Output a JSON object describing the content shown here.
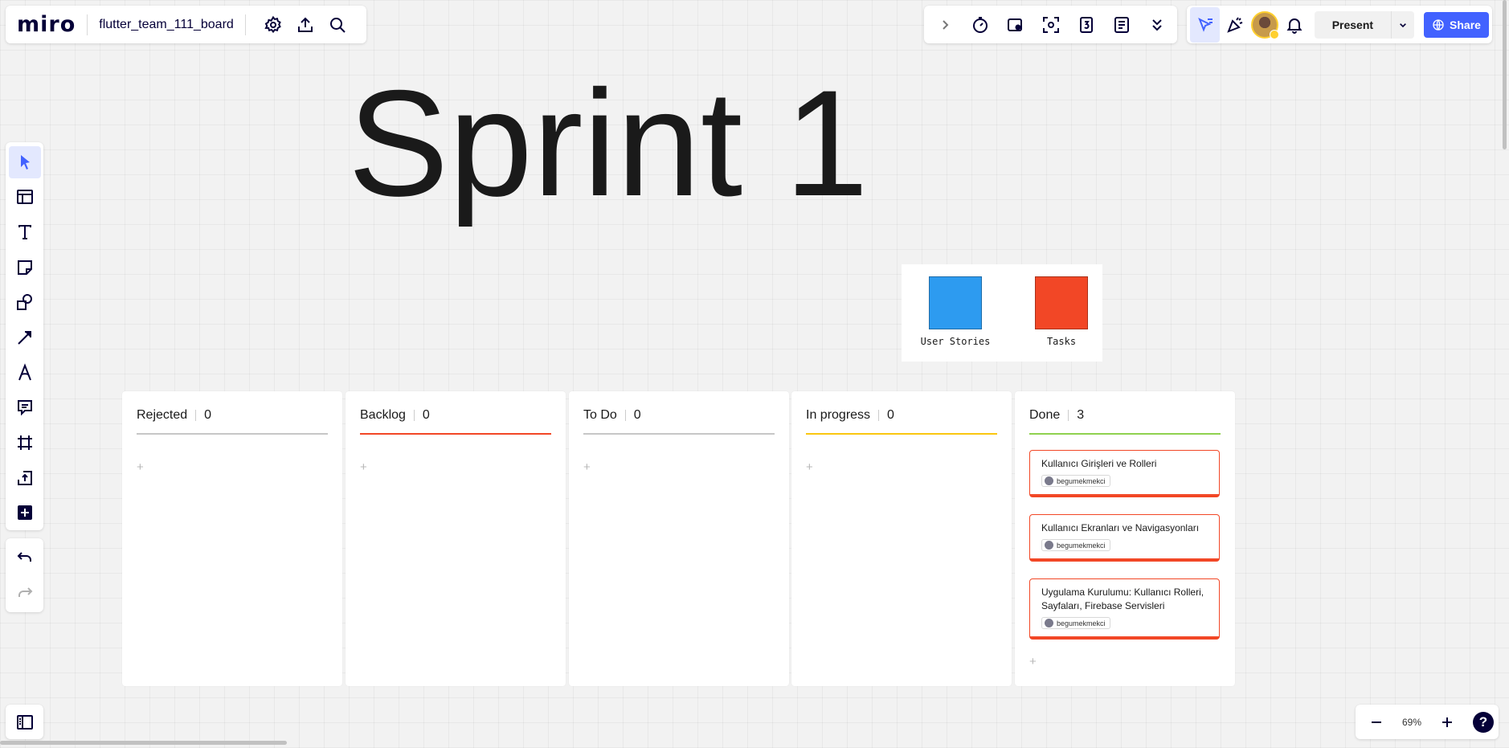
{
  "header": {
    "logo": "miro",
    "board_name": "flutter_team_111_board",
    "present_label": "Present",
    "share_label": "Share"
  },
  "icons": {
    "top_left": [
      "settings-icon",
      "upload-icon",
      "search-icon"
    ],
    "top_mid": [
      "chevron-right-icon",
      "timer-icon",
      "sticky-add-icon",
      "focus-icon",
      "counter-icon",
      "notes-icon",
      "double-chevron-down-icon"
    ],
    "top_right": [
      "cursor-filter-icon",
      "reaction-icon",
      "avatar",
      "bell-icon"
    ],
    "toolbar": [
      "select-icon",
      "templates-icon",
      "text-icon",
      "sticky-note-icon",
      "shapes-icon",
      "line-icon",
      "pen-icon",
      "comment-icon",
      "frame-icon",
      "upload-icon",
      "more-tools-icon"
    ]
  },
  "canvas": {
    "title": "Sprint 1",
    "legend": [
      {
        "label": "User Stories",
        "color": "#2d9bf0"
      },
      {
        "label": "Tasks",
        "color": "#f24726"
      }
    ]
  },
  "kanban": {
    "add_label": "+",
    "columns": [
      {
        "name": "Rejected",
        "count": "0",
        "line_color": "#c7c7c7",
        "cards": []
      },
      {
        "name": "Backlog",
        "count": "0",
        "line_color": "#f24726",
        "cards": []
      },
      {
        "name": "To Do",
        "count": "0",
        "line_color": "#c7c7c7",
        "cards": []
      },
      {
        "name": "In progress",
        "count": "0",
        "line_color": "#fac710",
        "cards": []
      },
      {
        "name": "Done",
        "count": "3",
        "line_color": "#8fd14f",
        "cards": [
          {
            "title": "Kullanıcı Girişleri ve Rolleri",
            "assignee": "begumekmekci"
          },
          {
            "title": "Kullanıcı Ekranları ve Navigasyonları",
            "assignee": "begumekmekci"
          },
          {
            "title": "Uygulama Kurulumu: Kullanıcı Rolleri, Sayfaları, Firebase Servisleri",
            "assignee": "begumekmekci"
          }
        ]
      }
    ]
  },
  "zoom": {
    "level": "69%",
    "help": "?"
  }
}
